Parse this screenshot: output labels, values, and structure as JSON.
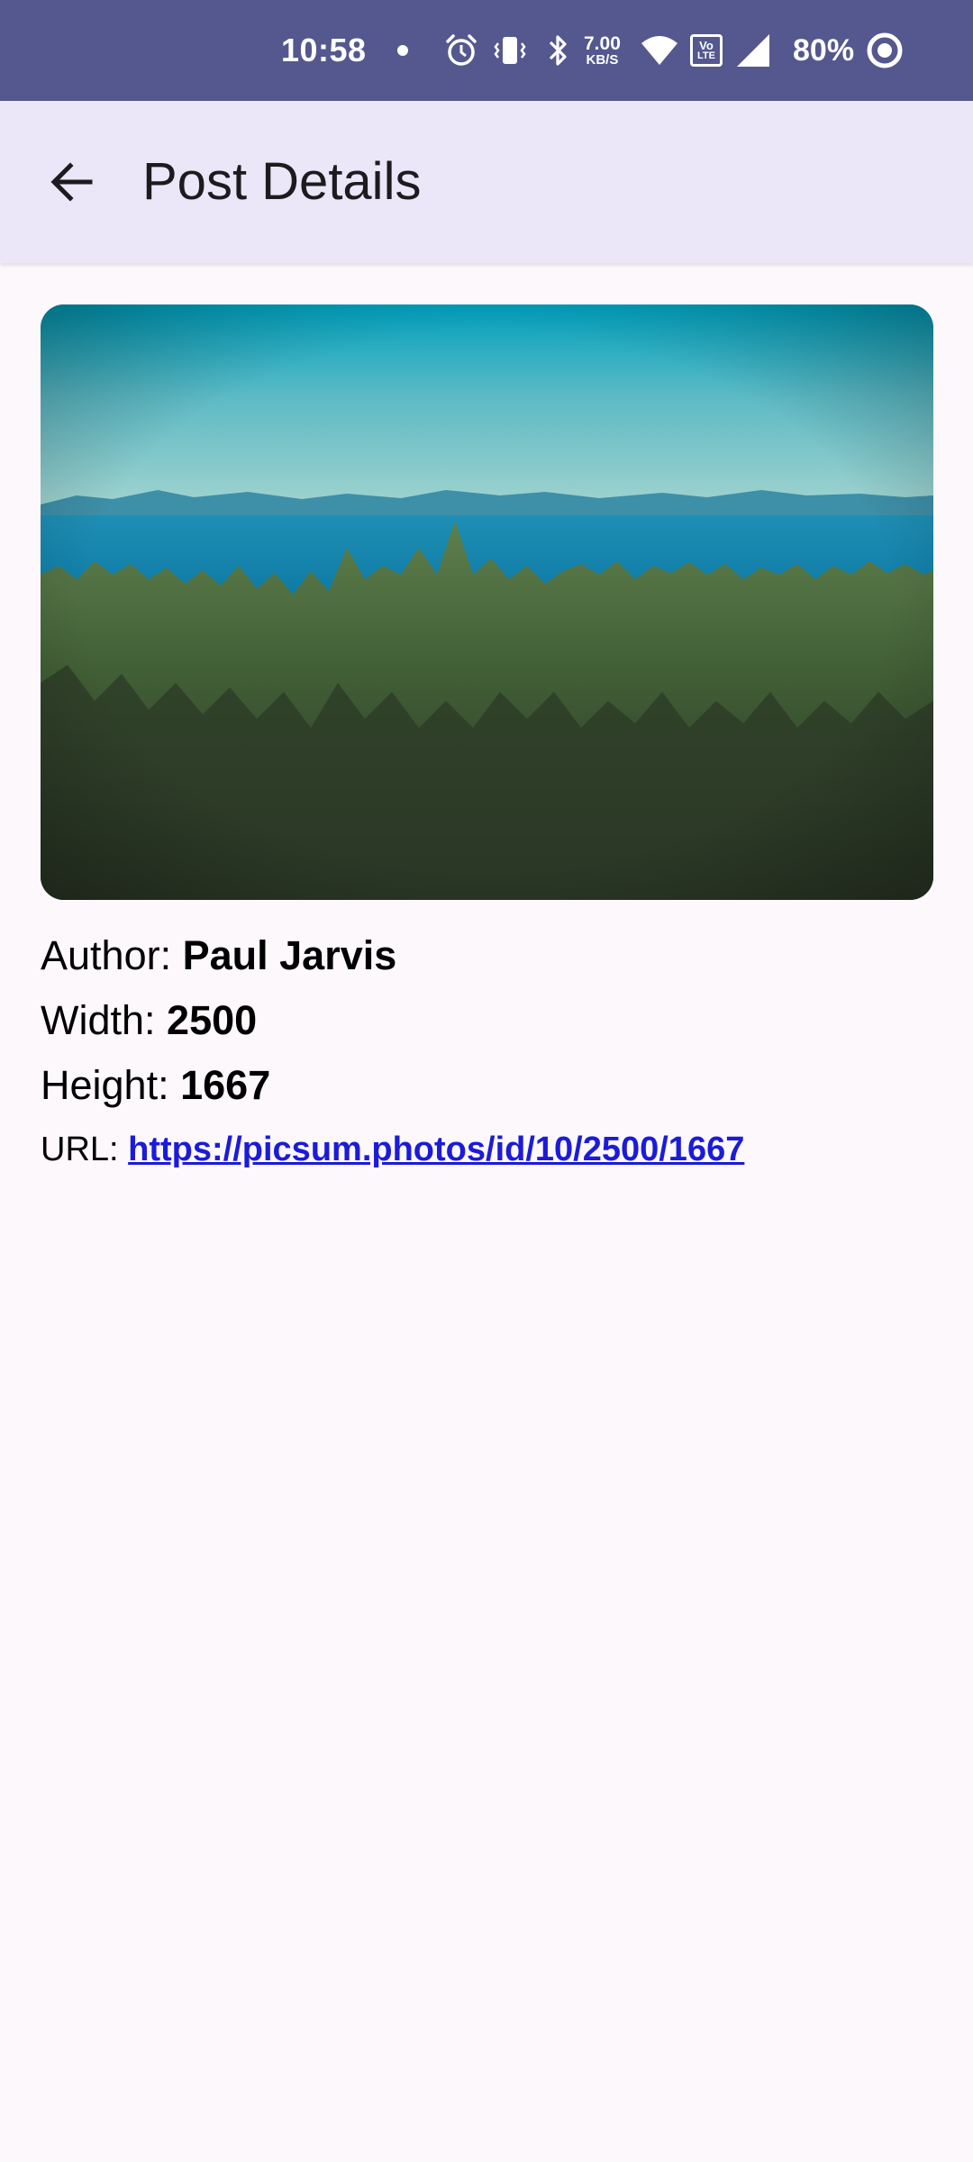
{
  "status_bar": {
    "time": "10:58",
    "net_speed_value": "7.00",
    "net_speed_unit": "KB/S",
    "volte_label_top": "Vo",
    "volte_label_bottom": "LTE",
    "battery": "80%",
    "background_color": "#54588E"
  },
  "app_bar": {
    "title": "Post Details",
    "back_icon": "arrow-back-icon",
    "background_color": "#EBE6F8"
  },
  "post": {
    "image_alt": "Forest overlooking a blue sea with distant mountains",
    "author_label": "Author:",
    "author": "Paul Jarvis",
    "width_label": "Width:",
    "width": "2500",
    "height_label": "Height:",
    "height": "1667",
    "url_label": "URL:",
    "url": "https://picsum.photos/id/10/2500/1667",
    "link_color": "#1B1BD9"
  }
}
